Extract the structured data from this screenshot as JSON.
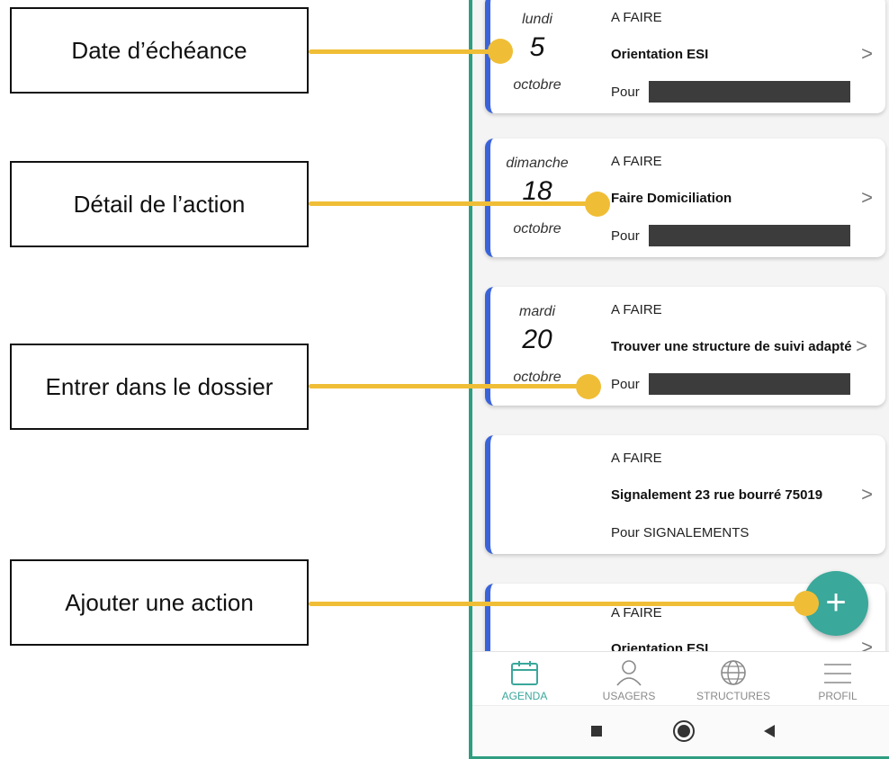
{
  "annotations": [
    {
      "label": "Date d’échéance"
    },
    {
      "label": "Détail de l’action"
    },
    {
      "label": "Entrer dans le dossier"
    },
    {
      "label": "Ajouter une action"
    }
  ],
  "cards": [
    {
      "weekday": "lundi",
      "day": "5",
      "month": "octobre",
      "status": "A FAIRE",
      "title": "Orientation ESI",
      "pour": "Pour",
      "redacted": true
    },
    {
      "weekday": "dimanche",
      "day": "18",
      "month": "octobre",
      "status": "A FAIRE",
      "title": "Faire Domiciliation",
      "pour": "Pour",
      "redacted": true
    },
    {
      "weekday": "mardi",
      "day": "20",
      "month": "octobre",
      "status": "A FAIRE",
      "title": "Trouver une structure de suivi adapté",
      "pour": "Pour",
      "redacted": true
    },
    {
      "weekday": "",
      "day": "",
      "month": "",
      "status": "A FAIRE",
      "title": "Signalement 23 rue bourré 75019",
      "pour": "Pour SIGNALEMENTS",
      "redacted": false
    },
    {
      "weekday": "",
      "day": "",
      "month": "",
      "status": "A FAIRE",
      "title": "Orientation ESI",
      "pour": "",
      "redacted": false
    }
  ],
  "chevron": ">",
  "fab_icon": "+",
  "tabs": [
    {
      "label": "AGENDA",
      "icon": "calendar-icon",
      "active": true
    },
    {
      "label": "USAGERS",
      "icon": "person-icon",
      "active": false
    },
    {
      "label": "STRUCTURES",
      "icon": "globe-icon",
      "active": false
    },
    {
      "label": "PROFIL",
      "icon": "menu-icon",
      "active": false
    }
  ],
  "colors": {
    "accent": "#3aa89a",
    "card_border": "#3a63d9",
    "annotation": "#f0be36",
    "frame": "#2e9e80"
  }
}
